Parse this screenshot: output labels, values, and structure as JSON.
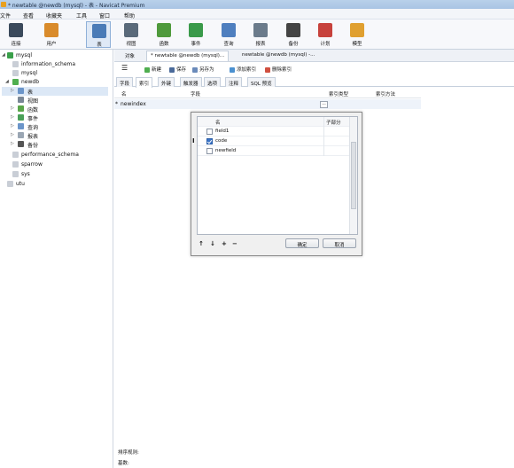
{
  "window": {
    "title": "* newtable @newdb (mysql) - 表 - Navicat Premium"
  },
  "menu": [
    "文件",
    "查看",
    "收藏夹",
    "工具",
    "窗口",
    "帮助"
  ],
  "toolbar": [
    {
      "label": "连接",
      "icon": "plug-icon",
      "color": "#3b4a5c"
    },
    {
      "label": "用户",
      "icon": "user-icon",
      "color": "#d98b2b"
    },
    {
      "label": "表",
      "icon": "table-icon",
      "color": "#4a7bb7"
    },
    {
      "label": "视图",
      "icon": "view-icon",
      "color": "#5a6a7a"
    },
    {
      "label": "函数",
      "icon": "function-icon",
      "color": "#4f9a3c"
    },
    {
      "label": "事件",
      "icon": "event-icon",
      "color": "#3a9a4a"
    },
    {
      "label": "查询",
      "icon": "query-icon",
      "color": "#4f7fbf"
    },
    {
      "label": "报表",
      "icon": "report-icon",
      "color": "#6b7b8b"
    },
    {
      "label": "备份",
      "icon": "backup-icon",
      "color": "#444444"
    },
    {
      "label": "计划",
      "icon": "schedule-icon",
      "color": "#c7423c"
    },
    {
      "label": "模型",
      "icon": "model-icon",
      "color": "#e0a030"
    }
  ],
  "sidebar": {
    "connections": [
      {
        "label": "mysql",
        "icon": "connection-icon",
        "expand": "◢"
      },
      {
        "label": "information_schema",
        "icon": "database-icon"
      },
      {
        "label": "mysql",
        "icon": "database-icon"
      },
      {
        "label": "newdb",
        "icon": "database-open-icon",
        "expand": "◢"
      },
      {
        "label": "表",
        "icon": "tables-icon",
        "expand": "▷"
      },
      {
        "label": "视图",
        "icon": "views-icon"
      },
      {
        "label": "函数",
        "icon": "functions-icon",
        "expand": "▷"
      },
      {
        "label": "事件",
        "icon": "events-icon",
        "expand": "▷"
      },
      {
        "label": "查询",
        "icon": "queries-icon",
        "expand": "▷"
      },
      {
        "label": "报表",
        "icon": "reports-icon",
        "expand": "▷"
      },
      {
        "label": "备份",
        "icon": "backups-icon",
        "expand": "▷"
      },
      {
        "label": "performance_schema",
        "icon": "database-icon"
      },
      {
        "label": "sparrow",
        "icon": "database-icon"
      },
      {
        "label": "sys",
        "icon": "database-icon"
      },
      {
        "label": "utu",
        "icon": "connection-icon"
      }
    ]
  },
  "object_tabs": [
    "对象",
    "* newtable @newdb (mysql)...",
    "newtable @newdb (mysql) -..."
  ],
  "edit_toolbar": {
    "menu_icon": "☰",
    "new": "新建",
    "save": "保存",
    "save_as": "另存为",
    "add_index": "添加索引",
    "delete_index": "删除索引"
  },
  "sub_tabs": [
    "字段",
    "索引",
    "外键",
    "触发器",
    "选项",
    "注释",
    "SQL 预览"
  ],
  "grid": {
    "headers": {
      "name": "名",
      "fields": "字段",
      "index_type": "索引类型",
      "index_method": "索引方法"
    },
    "rows": [
      {
        "marker": "*",
        "name": "newindex",
        "fields": "",
        "ellipsis": "..."
      }
    ]
  },
  "dialog": {
    "headers": {
      "name": "名",
      "sub_part": "子部分"
    },
    "fields": [
      {
        "name": "field1",
        "checked": false
      },
      {
        "name": "code",
        "checked": true
      },
      {
        "name": "newfield",
        "checked": false
      }
    ],
    "text_cursor": "I",
    "arrows": [
      "↑",
      "↓",
      "+",
      "−"
    ],
    "ok": "确定",
    "cancel": "取消"
  },
  "bottom": {
    "sort_rule": "排序规则:",
    "cardinality": "基数:"
  }
}
